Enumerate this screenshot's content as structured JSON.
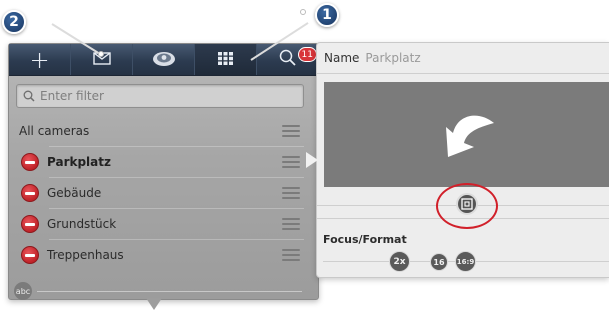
{
  "toolbar": {
    "buttons": [
      {
        "icon": "plus-icon",
        "glyph": "+"
      },
      {
        "icon": "envelope-icon",
        "glyph": "✉"
      },
      {
        "icon": "dome-camera-icon",
        "glyph": ""
      },
      {
        "icon": "grid-icon",
        "glyph": ""
      },
      {
        "icon": "search-icon",
        "glyph": ""
      }
    ],
    "badge_count": "11"
  },
  "filter": {
    "placeholder": "Enter filter"
  },
  "list": {
    "header": "All cameras",
    "cameras": [
      {
        "label": "Parkplatz",
        "selected": true
      },
      {
        "label": "Gebäude",
        "selected": false
      },
      {
        "label": "Grundstück",
        "selected": false
      },
      {
        "label": "Treppenhaus",
        "selected": false
      }
    ],
    "sort_button": "abc"
  },
  "properties": {
    "name_label": "Name",
    "name_value": "Parkplatz",
    "focus_format_label": "Focus/Format",
    "format_buttons": [
      "2x",
      "16",
      "16:9"
    ]
  },
  "callouts": [
    "2",
    "1"
  ],
  "colors": {
    "toolbar": "#2c3b50",
    "remove": "#c02228",
    "callout": "#1f3f6c",
    "highlight": "#d1202a"
  }
}
